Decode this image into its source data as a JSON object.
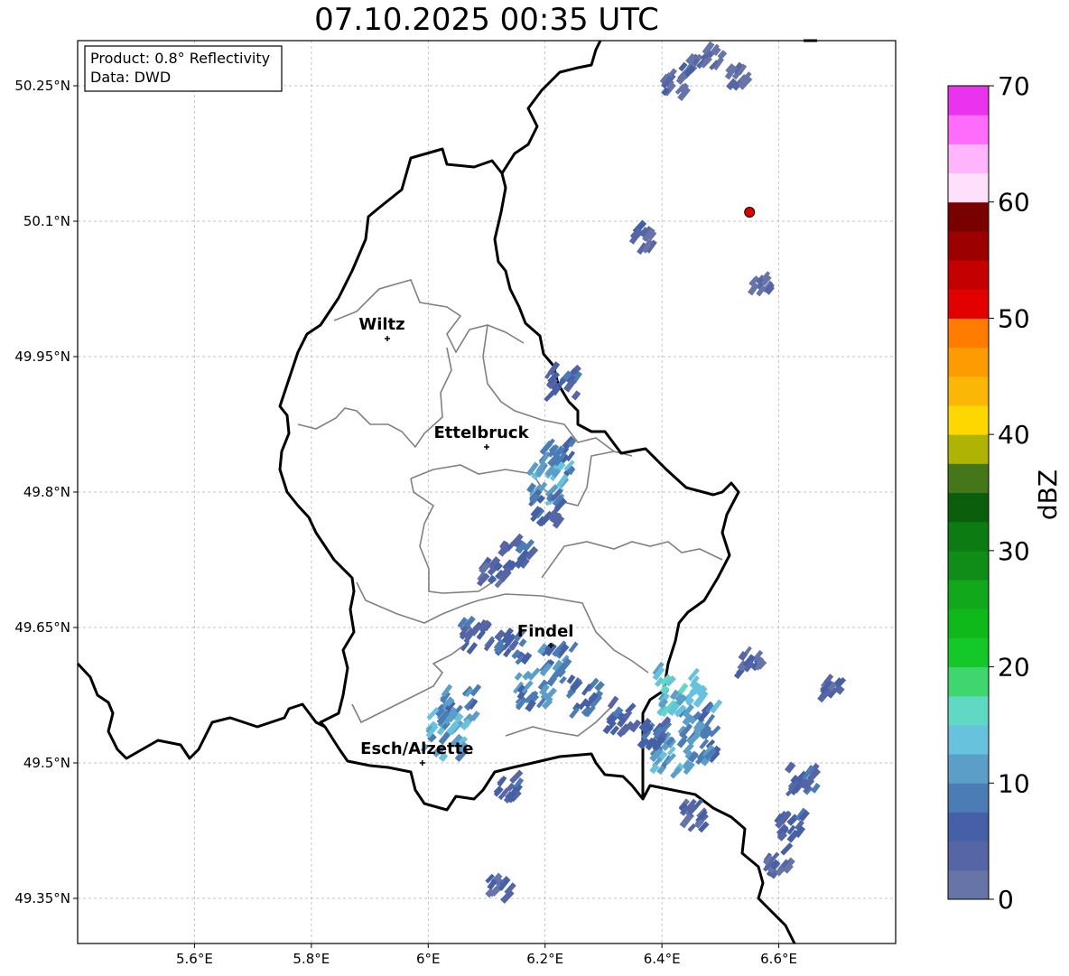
{
  "title": "07.10.2025 00:35 UTC",
  "info": {
    "product": "Product: 0.8° Reflectivity",
    "source": "Data: DWD"
  },
  "map": {
    "lon_range": [
      5.4,
      6.8
    ],
    "lat_range": [
      49.3,
      50.3
    ],
    "lon_ticks": [
      5.6,
      5.8,
      6.0,
      6.2,
      6.4,
      6.6
    ],
    "lon_tick_labels": [
      "5.6°E",
      "5.8°E",
      "6°E",
      "6.2°E",
      "6.4°E",
      "6.6°E"
    ],
    "lat_ticks": [
      49.35,
      49.5,
      49.65,
      49.8,
      49.95,
      50.1,
      50.25
    ],
    "lat_tick_labels": [
      "49.35°N",
      "49.5°N",
      "49.65°N",
      "49.8°N",
      "49.95°N",
      "50.1°N",
      "50.25°N"
    ],
    "gridlines": true,
    "cities": [
      {
        "name": "Wiltz",
        "lon": 5.93,
        "lat": 49.97
      },
      {
        "name": "Ettelbruck",
        "lon": 6.1,
        "lat": 49.85
      },
      {
        "name": "Findel",
        "lon": 6.21,
        "lat": 49.63
      },
      {
        "name": "Esch/Alzette",
        "lon": 5.99,
        "lat": 49.5
      }
    ],
    "radar_site": {
      "lon": 6.55,
      "lat": 50.11,
      "color": "#e30000"
    },
    "echo_cells": [
      {
        "lon": 6.45,
        "lat": 50.27,
        "dbz": 3
      },
      {
        "lon": 6.49,
        "lat": 50.28,
        "dbz": 2
      },
      {
        "lon": 6.53,
        "lat": 50.26,
        "dbz": 2
      },
      {
        "lon": 6.42,
        "lat": 50.25,
        "dbz": 3
      },
      {
        "lon": 6.37,
        "lat": 50.08,
        "dbz": 3
      },
      {
        "lon": 6.57,
        "lat": 50.03,
        "dbz": 2
      },
      {
        "lon": 6.23,
        "lat": 49.92,
        "dbz": 6
      },
      {
        "lon": 6.22,
        "lat": 49.84,
        "dbz": 8
      },
      {
        "lon": 6.21,
        "lat": 49.81,
        "dbz": 12
      },
      {
        "lon": 6.2,
        "lat": 49.78,
        "dbz": 6
      },
      {
        "lon": 6.15,
        "lat": 49.73,
        "dbz": 6
      },
      {
        "lon": 6.11,
        "lat": 49.71,
        "dbz": 4
      },
      {
        "lon": 6.08,
        "lat": 49.64,
        "dbz": 6
      },
      {
        "lon": 6.14,
        "lat": 49.63,
        "dbz": 7
      },
      {
        "lon": 6.22,
        "lat": 49.61,
        "dbz": 8
      },
      {
        "lon": 6.18,
        "lat": 49.58,
        "dbz": 9
      },
      {
        "lon": 6.27,
        "lat": 49.57,
        "dbz": 7
      },
      {
        "lon": 6.05,
        "lat": 49.56,
        "dbz": 9
      },
      {
        "lon": 6.03,
        "lat": 49.53,
        "dbz": 12
      },
      {
        "lon": 6.33,
        "lat": 49.55,
        "dbz": 6
      },
      {
        "lon": 6.43,
        "lat": 49.58,
        "dbz": 14
      },
      {
        "lon": 6.46,
        "lat": 49.55,
        "dbz": 10
      },
      {
        "lon": 6.42,
        "lat": 49.51,
        "dbz": 11
      },
      {
        "lon": 6.47,
        "lat": 49.52,
        "dbz": 8
      },
      {
        "lon": 6.39,
        "lat": 49.53,
        "dbz": 7
      },
      {
        "lon": 6.55,
        "lat": 49.61,
        "dbz": 4
      },
      {
        "lon": 6.64,
        "lat": 49.48,
        "dbz": 6
      },
      {
        "lon": 6.62,
        "lat": 49.43,
        "dbz": 5
      },
      {
        "lon": 6.6,
        "lat": 49.39,
        "dbz": 4
      },
      {
        "lon": 6.45,
        "lat": 49.44,
        "dbz": 4
      },
      {
        "lon": 6.14,
        "lat": 49.47,
        "dbz": 5
      },
      {
        "lon": 6.12,
        "lat": 49.36,
        "dbz": 3
      },
      {
        "lon": 6.69,
        "lat": 49.58,
        "dbz": 3
      }
    ]
  },
  "colorbar": {
    "label": "dBZ",
    "min": 0,
    "max": 70,
    "tick_values": [
      0,
      10,
      20,
      30,
      40,
      50,
      60,
      70
    ],
    "tick_labels": [
      "0",
      "10",
      "20",
      "30",
      "40",
      "50",
      "60",
      "70"
    ],
    "colors": [
      "#6674a8",
      "#5565a5",
      "#4560a6",
      "#4b7cb5",
      "#5b9ec8",
      "#66c2dd",
      "#5fd8c4",
      "#3fd670",
      "#14c829",
      "#10b91a",
      "#11a81c",
      "#108c18",
      "#0c7c12",
      "#0a5e0c",
      "#45761a",
      "#afb304",
      "#ffd700",
      "#fcb605",
      "#fd9c00",
      "#ff7c00",
      "#e20000",
      "#c40000",
      "#9c0000",
      "#7a0000",
      "#ffe0fc",
      "#ffb4fc",
      "#ff6cfc",
      "#ea33ee"
    ]
  }
}
